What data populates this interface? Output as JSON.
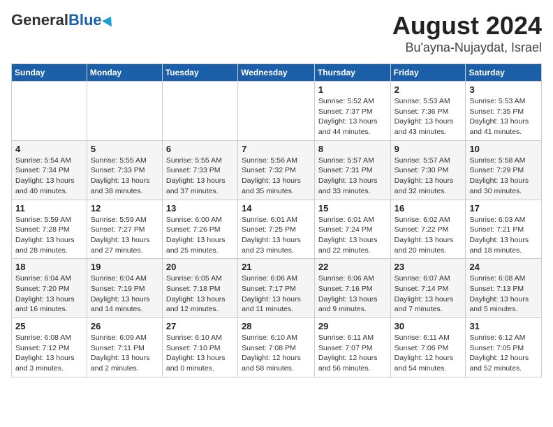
{
  "header": {
    "logo_general": "General",
    "logo_blue": "Blue",
    "title": "August 2024",
    "subtitle": "Bu'ayna-Nujaydat, Israel"
  },
  "weekdays": [
    "Sunday",
    "Monday",
    "Tuesday",
    "Wednesday",
    "Thursday",
    "Friday",
    "Saturday"
  ],
  "weeks": [
    [
      {
        "day": "",
        "info": ""
      },
      {
        "day": "",
        "info": ""
      },
      {
        "day": "",
        "info": ""
      },
      {
        "day": "",
        "info": ""
      },
      {
        "day": "1",
        "info": "Sunrise: 5:52 AM\nSunset: 7:37 PM\nDaylight: 13 hours\nand 44 minutes."
      },
      {
        "day": "2",
        "info": "Sunrise: 5:53 AM\nSunset: 7:36 PM\nDaylight: 13 hours\nand 43 minutes."
      },
      {
        "day": "3",
        "info": "Sunrise: 5:53 AM\nSunset: 7:35 PM\nDaylight: 13 hours\nand 41 minutes."
      }
    ],
    [
      {
        "day": "4",
        "info": "Sunrise: 5:54 AM\nSunset: 7:34 PM\nDaylight: 13 hours\nand 40 minutes."
      },
      {
        "day": "5",
        "info": "Sunrise: 5:55 AM\nSunset: 7:33 PM\nDaylight: 13 hours\nand 38 minutes."
      },
      {
        "day": "6",
        "info": "Sunrise: 5:55 AM\nSunset: 7:33 PM\nDaylight: 13 hours\nand 37 minutes."
      },
      {
        "day": "7",
        "info": "Sunrise: 5:56 AM\nSunset: 7:32 PM\nDaylight: 13 hours\nand 35 minutes."
      },
      {
        "day": "8",
        "info": "Sunrise: 5:57 AM\nSunset: 7:31 PM\nDaylight: 13 hours\nand 33 minutes."
      },
      {
        "day": "9",
        "info": "Sunrise: 5:57 AM\nSunset: 7:30 PM\nDaylight: 13 hours\nand 32 minutes."
      },
      {
        "day": "10",
        "info": "Sunrise: 5:58 AM\nSunset: 7:29 PM\nDaylight: 13 hours\nand 30 minutes."
      }
    ],
    [
      {
        "day": "11",
        "info": "Sunrise: 5:59 AM\nSunset: 7:28 PM\nDaylight: 13 hours\nand 28 minutes."
      },
      {
        "day": "12",
        "info": "Sunrise: 5:59 AM\nSunset: 7:27 PM\nDaylight: 13 hours\nand 27 minutes."
      },
      {
        "day": "13",
        "info": "Sunrise: 6:00 AM\nSunset: 7:26 PM\nDaylight: 13 hours\nand 25 minutes."
      },
      {
        "day": "14",
        "info": "Sunrise: 6:01 AM\nSunset: 7:25 PM\nDaylight: 13 hours\nand 23 minutes."
      },
      {
        "day": "15",
        "info": "Sunrise: 6:01 AM\nSunset: 7:24 PM\nDaylight: 13 hours\nand 22 minutes."
      },
      {
        "day": "16",
        "info": "Sunrise: 6:02 AM\nSunset: 7:22 PM\nDaylight: 13 hours\nand 20 minutes."
      },
      {
        "day": "17",
        "info": "Sunrise: 6:03 AM\nSunset: 7:21 PM\nDaylight: 13 hours\nand 18 minutes."
      }
    ],
    [
      {
        "day": "18",
        "info": "Sunrise: 6:04 AM\nSunset: 7:20 PM\nDaylight: 13 hours\nand 16 minutes."
      },
      {
        "day": "19",
        "info": "Sunrise: 6:04 AM\nSunset: 7:19 PM\nDaylight: 13 hours\nand 14 minutes."
      },
      {
        "day": "20",
        "info": "Sunrise: 6:05 AM\nSunset: 7:18 PM\nDaylight: 13 hours\nand 12 minutes."
      },
      {
        "day": "21",
        "info": "Sunrise: 6:06 AM\nSunset: 7:17 PM\nDaylight: 13 hours\nand 11 minutes."
      },
      {
        "day": "22",
        "info": "Sunrise: 6:06 AM\nSunset: 7:16 PM\nDaylight: 13 hours\nand 9 minutes."
      },
      {
        "day": "23",
        "info": "Sunrise: 6:07 AM\nSunset: 7:14 PM\nDaylight: 13 hours\nand 7 minutes."
      },
      {
        "day": "24",
        "info": "Sunrise: 6:08 AM\nSunset: 7:13 PM\nDaylight: 13 hours\nand 5 minutes."
      }
    ],
    [
      {
        "day": "25",
        "info": "Sunrise: 6:08 AM\nSunset: 7:12 PM\nDaylight: 13 hours\nand 3 minutes."
      },
      {
        "day": "26",
        "info": "Sunrise: 6:09 AM\nSunset: 7:11 PM\nDaylight: 13 hours\nand 2 minutes."
      },
      {
        "day": "27",
        "info": "Sunrise: 6:10 AM\nSunset: 7:10 PM\nDaylight: 13 hours\nand 0 minutes."
      },
      {
        "day": "28",
        "info": "Sunrise: 6:10 AM\nSunset: 7:08 PM\nDaylight: 12 hours\nand 58 minutes."
      },
      {
        "day": "29",
        "info": "Sunrise: 6:11 AM\nSunset: 7:07 PM\nDaylight: 12 hours\nand 56 minutes."
      },
      {
        "day": "30",
        "info": "Sunrise: 6:11 AM\nSunset: 7:06 PM\nDaylight: 12 hours\nand 54 minutes."
      },
      {
        "day": "31",
        "info": "Sunrise: 6:12 AM\nSunset: 7:05 PM\nDaylight: 12 hours\nand 52 minutes."
      }
    ]
  ]
}
